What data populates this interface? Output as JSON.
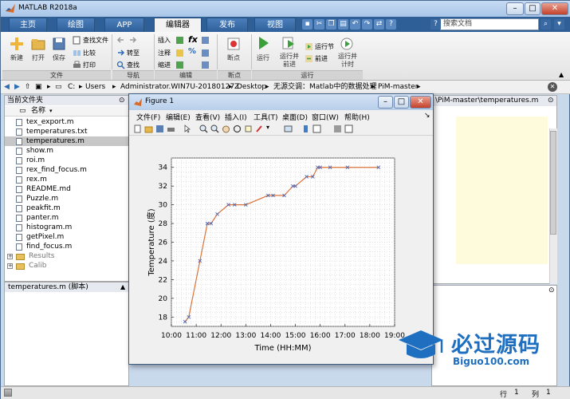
{
  "window": {
    "title": "MATLAB R2018a",
    "min": "–",
    "max": "□",
    "close": "✕"
  },
  "tabs": [
    "主页",
    "绘图",
    "APP",
    "编辑器",
    "发布",
    "视图"
  ],
  "search": {
    "placeholder": "搜索文档"
  },
  "ribbon": {
    "file": {
      "new": "新建",
      "open": "打开",
      "save": "保存",
      "find_files": "查找文件",
      "compare": "比较",
      "print": "打印",
      "group": "文件"
    },
    "nav": {
      "goto": "转至",
      "find": "查找",
      "group": "导航"
    },
    "edit": {
      "insert": "插入",
      "comment": "注释",
      "indent": "缩进",
      "fx": "fx",
      "percent": "%",
      "group": "编辑"
    },
    "breakpoints": {
      "label": "断点",
      "group": "断点"
    },
    "run": {
      "run": "运行",
      "run_advance": "运行并\n前进",
      "run_section": "运行节",
      "advance": "前进",
      "run_time": "运行并\n计时",
      "group": "运行"
    }
  },
  "address": {
    "parts": [
      "C:",
      "Users",
      "Administrator.WIN7U-20180127Z",
      "Desktop",
      "无源交调：Matlab中的数据处理",
      "PiM-master"
    ]
  },
  "left_panel": {
    "title": "当前文件夹",
    "col_name": "名称",
    "files": [
      "tex_export.m",
      "temperatures.txt",
      "temperatures.m",
      "show.m",
      "roi.m",
      "rex_find_focus.m",
      "rex.m",
      "README.md",
      "Puzzle.m",
      "peakfit.m",
      "panter.m",
      "histogram.m",
      "getPixel.m",
      "find_focus.m"
    ],
    "selected_index": 2,
    "folders": [
      "Results",
      "Calib"
    ]
  },
  "detail_panel": {
    "title": "temperatures.m  (脚本)"
  },
  "editor": {
    "title": "\\PiM-master\\temperatures.m"
  },
  "status": {
    "row_label": "行",
    "row_value": "1",
    "col_label": "列",
    "col_value": "1"
  },
  "figure": {
    "title": "Figure 1",
    "menu": [
      "文件(F)",
      "编辑(E)",
      "查看(V)",
      "插入(I)",
      "工具(T)",
      "桌面(D)",
      "窗口(W)",
      "帮助(H)"
    ]
  },
  "chart_data": {
    "type": "line",
    "xlabel": "Time (HH:MM)",
    "ylabel": "Temperature (度)",
    "x_ticks": [
      "10:00",
      "11:00",
      "12:00",
      "13:00",
      "14:00",
      "15:00",
      "16:00",
      "17:00",
      "18:00",
      "19:00"
    ],
    "y_ticks": [
      18,
      20,
      22,
      24,
      26,
      28,
      30,
      32,
      34
    ],
    "xlim": [
      10.0,
      19.0
    ],
    "ylim": [
      17,
      35
    ],
    "grid": "minor",
    "line_color": "#d9733a",
    "marker_color": "#4a5fb5",
    "series": [
      {
        "markers_x": [
          10.55,
          10.7,
          11.15,
          11.45,
          11.6,
          11.85,
          12.3,
          12.55,
          13.0,
          13.9,
          14.1,
          14.55,
          14.9,
          15.0,
          15.45,
          15.7,
          15.9,
          16.0,
          16.4,
          17.1,
          18.35
        ],
        "markers_y": [
          17.5,
          18,
          24,
          28,
          28,
          29,
          30,
          30,
          30,
          31,
          31,
          31,
          32,
          32,
          33,
          33,
          34,
          34,
          34,
          34,
          34
        ]
      }
    ]
  },
  "watermark": {
    "text": "必过源码",
    "sub": "Biguo100.com"
  }
}
